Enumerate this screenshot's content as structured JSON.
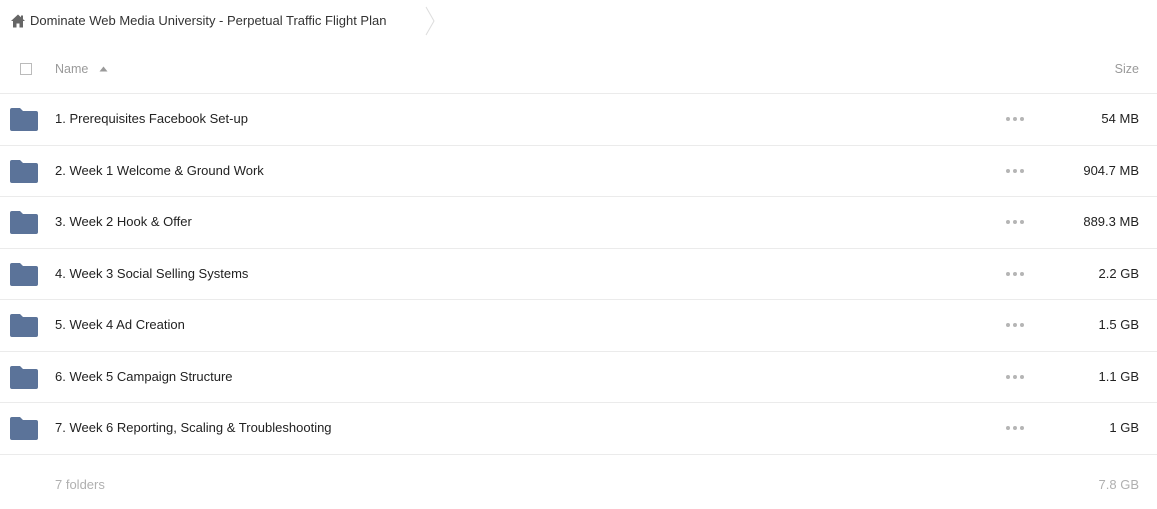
{
  "breadcrumb": {
    "icon": "home-icon",
    "label": "Dominate Web Media University - Perpetual Traffic Flight Plan"
  },
  "header": {
    "name_label": "Name",
    "size_label": "Size",
    "sort": "ascending"
  },
  "colors": {
    "folder": "#5b7399",
    "border": "#ebebeb",
    "muted_text": "#9a9a9a"
  },
  "rows": [
    {
      "name": "1. Prerequisites Facebook Set-up",
      "size": "54 MB",
      "icon": "folder-icon"
    },
    {
      "name": "2. Week 1 Welcome & Ground Work",
      "size": "904.7 MB",
      "icon": "folder-icon"
    },
    {
      "name": "3. Week 2 Hook & Offer",
      "size": "889.3 MB",
      "icon": "folder-icon"
    },
    {
      "name": "4. Week 3 Social Selling Systems",
      "size": "2.2 GB",
      "icon": "folder-icon"
    },
    {
      "name": "5. Week 4 Ad Creation",
      "size": "1.5 GB",
      "icon": "folder-icon"
    },
    {
      "name": "6. Week 5 Campaign Structure",
      "size": "1.1 GB",
      "icon": "folder-icon"
    },
    {
      "name": "7. Week 6 Reporting, Scaling & Troubleshooting",
      "size": "1 GB",
      "icon": "folder-icon"
    }
  ],
  "footer": {
    "count": "7 folders",
    "total_size": "7.8 GB"
  }
}
